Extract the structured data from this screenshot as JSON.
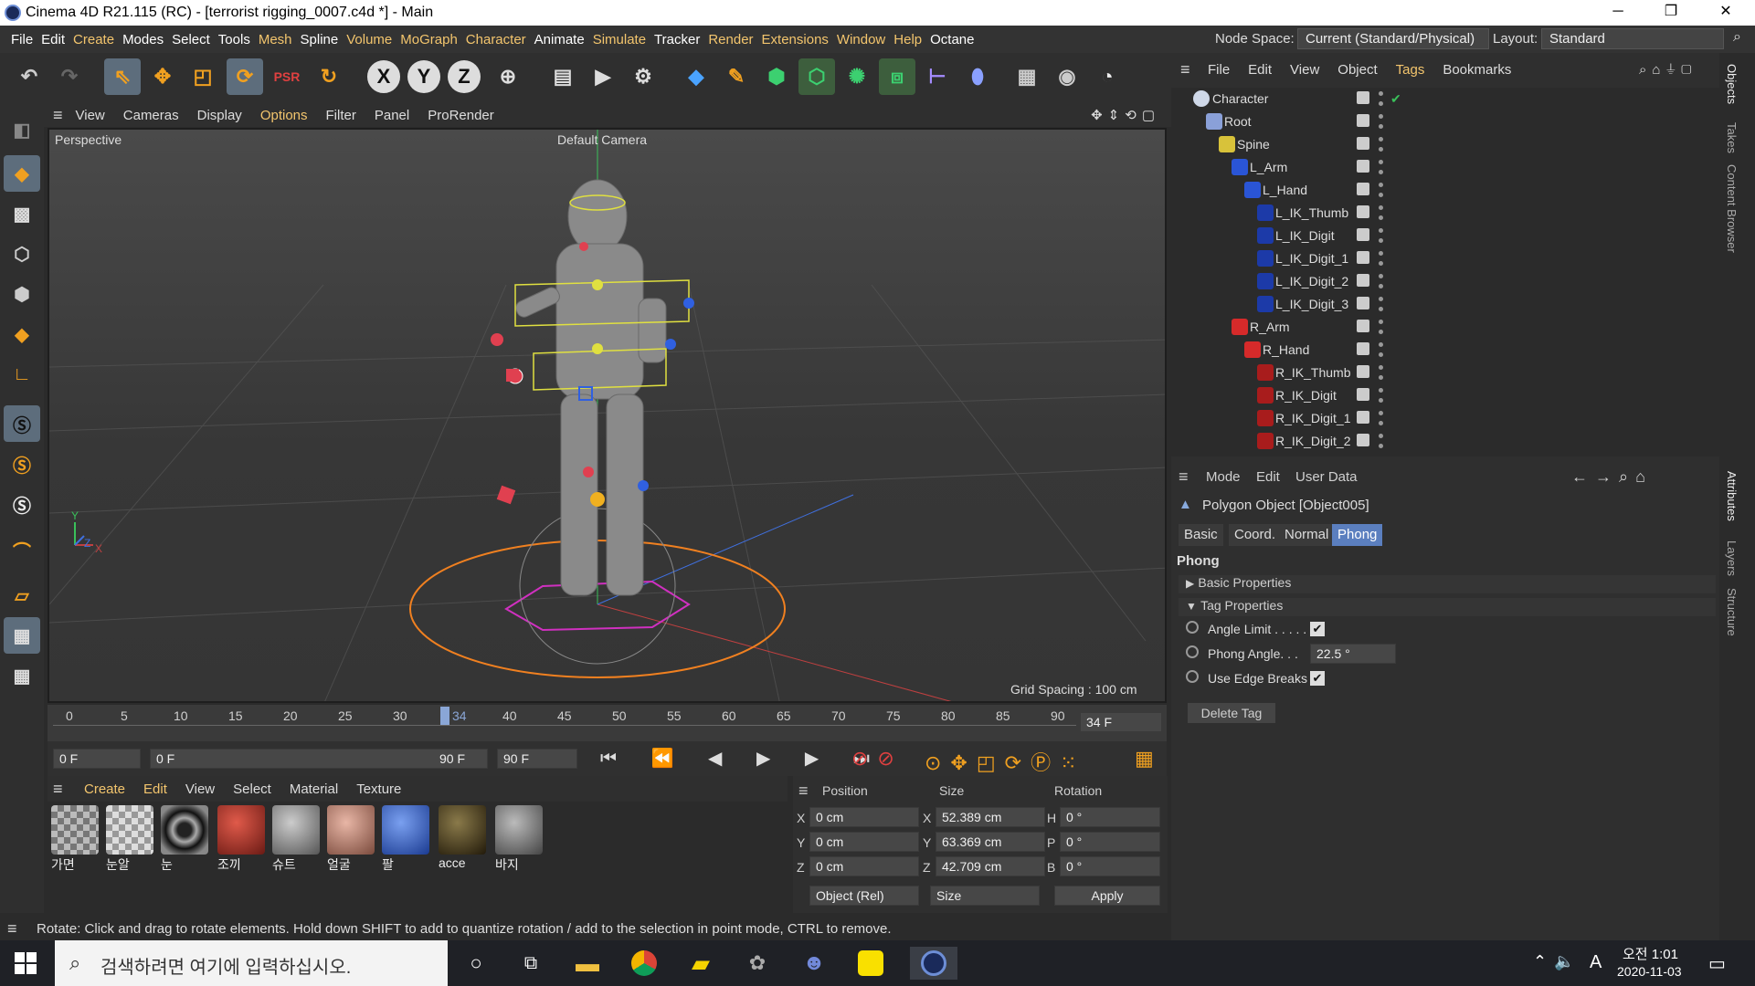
{
  "titlebar": {
    "title": "Cinema 4D R21.115 (RC) - [terrorist rigging_0007.c4d *] - Main",
    "minimize": "─",
    "maximize": "❐",
    "close": "✕"
  },
  "menubar": {
    "items": [
      "File",
      "Edit",
      "Create",
      "Modes",
      "Select",
      "Tools",
      "Mesh",
      "Spline",
      "Volume",
      "MoGraph",
      "Character",
      "Animate",
      "Simulate",
      "Tracker",
      "Render",
      "Extensions",
      "Window",
      "Help",
      "Octane"
    ]
  },
  "nodespace": {
    "label": "Node Space:",
    "value": "Current (Standard/Physical)",
    "layout_label": "Layout:",
    "layout_value": "Standard"
  },
  "toolbar": {
    "x_label": "X",
    "y_label": "Y",
    "z_label": "Z"
  },
  "viewport_menu": {
    "items": [
      "View",
      "Cameras",
      "Display",
      "Options",
      "Filter",
      "Panel",
      "ProRender"
    ]
  },
  "viewport": {
    "view_name": "Perspective",
    "camera": "Default Camera",
    "grid_spacing": "Grid Spacing : 100 cm",
    "axis_y": "Y",
    "axis_z": "Z",
    "axis_x": "X"
  },
  "timeline": {
    "ticks": [
      "0",
      "5",
      "10",
      "15",
      "20",
      "25",
      "30",
      "34",
      "40",
      "45",
      "50",
      "55",
      "60",
      "65",
      "70",
      "75",
      "80",
      "85",
      "90"
    ],
    "current_frame": "34 F"
  },
  "playbar": {
    "start": "0 F",
    "range_start": "0 F",
    "range_end": "90 F",
    "end": "90 F"
  },
  "material_menu": {
    "items": [
      "Create",
      "Edit",
      "View",
      "Select",
      "Material",
      "Texture"
    ]
  },
  "materials": [
    {
      "name": "가면",
      "color": "#9a9a9a"
    },
    {
      "name": "눈알",
      "color": "#c8c8c8"
    },
    {
      "name": "눈",
      "color": "#1a1a1a"
    },
    {
      "name": "조끼",
      "color": "#b33a2c"
    },
    {
      "name": "슈트",
      "color": "#8a8a88"
    },
    {
      "name": "얼굴",
      "color": "#b98b7c"
    },
    {
      "name": "팔",
      "color": "#3a6acb"
    },
    {
      "name": "acce",
      "color": "#4a3b22"
    },
    {
      "name": "바지",
      "color": "#777"
    }
  ],
  "coords": {
    "headers": [
      "Position",
      "Size",
      "Rotation"
    ],
    "position": [
      {
        "axis": "X",
        "value": "0 cm"
      },
      {
        "axis": "Y",
        "value": "0 cm"
      },
      {
        "axis": "Z",
        "value": "0 cm"
      }
    ],
    "size": [
      {
        "axis": "X",
        "value": "52.389 cm"
      },
      {
        "axis": "Y",
        "value": "63.369 cm"
      },
      {
        "axis": "Z",
        "value": "42.709 cm"
      }
    ],
    "rotation": [
      {
        "axis": "H",
        "value": "0 °"
      },
      {
        "axis": "P",
        "value": "0 °"
      },
      {
        "axis": "B",
        "value": "0 °"
      }
    ],
    "mode": "Object (Rel)",
    "size_mode": "Size",
    "apply": "Apply"
  },
  "status": "Rotate: Click and drag to rotate elements. Hold down SHIFT to add to quantize rotation / add to the selection in point mode, CTRL to remove.",
  "objects_menu": {
    "items": [
      "File",
      "Edit",
      "View",
      "Object",
      "Tags",
      "Bookmarks"
    ]
  },
  "objects": [
    {
      "name": "Character",
      "color": "#cfd8e8",
      "level": 0
    },
    {
      "name": "Root",
      "color": "#8aa0d8",
      "level": 1
    },
    {
      "name": "Spine",
      "color": "#d8c23a",
      "level": 2
    },
    {
      "name": "L_Arm",
      "color": "#2a55d6",
      "level": 3
    },
    {
      "name": "L_Hand",
      "color": "#2a55d6",
      "level": 4
    },
    {
      "name": "L_IK_Thumb",
      "color": "#1c3aa8",
      "level": 5
    },
    {
      "name": "L_IK_Digit",
      "color": "#1c3aa8",
      "level": 5
    },
    {
      "name": "L_IK_Digit_1",
      "color": "#1c3aa8",
      "level": 5
    },
    {
      "name": "L_IK_Digit_2",
      "color": "#1c3aa8",
      "level": 5
    },
    {
      "name": "L_IK_Digit_3",
      "color": "#1c3aa8",
      "level": 5
    },
    {
      "name": "R_Arm",
      "color": "#d62a2a",
      "level": 3
    },
    {
      "name": "R_Hand",
      "color": "#d62a2a",
      "level": 4
    },
    {
      "name": "R_IK_Thumb",
      "color": "#a81c1c",
      "level": 5
    },
    {
      "name": "R_IK_Digit",
      "color": "#a81c1c",
      "level": 5
    },
    {
      "name": "R_IK_Digit_1",
      "color": "#a81c1c",
      "level": 5
    },
    {
      "name": "R_IK_Digit_2",
      "color": "#a81c1c",
      "level": 5
    }
  ],
  "attributes": {
    "menu": [
      "Mode",
      "Edit",
      "User Data"
    ],
    "object_title": "Polygon Object [Object005]",
    "tabs": [
      "Basic",
      "Coord.",
      "Normal",
      "Phong"
    ],
    "section": "Phong",
    "basic_props": "Basic Properties",
    "tag_props": "Tag Properties",
    "angle_limit": "Angle Limit . . . . .",
    "phong_angle": "Phong Angle. . .",
    "phong_angle_value": "22.5 °",
    "use_edge_breaks": "Use Edge Breaks",
    "delete_tag": "Delete Tag"
  },
  "right_tabs": {
    "objects": "Objects",
    "takes": "Takes",
    "content_browser": "Content Browser",
    "attributes": "Attributes",
    "layers": "Layers",
    "structure": "Structure"
  },
  "taskbar": {
    "search_placeholder": "검색하려면 여기에 입력하십시오.",
    "time": "오전 1:01",
    "date": "2020-11-03",
    "ime": "A"
  }
}
